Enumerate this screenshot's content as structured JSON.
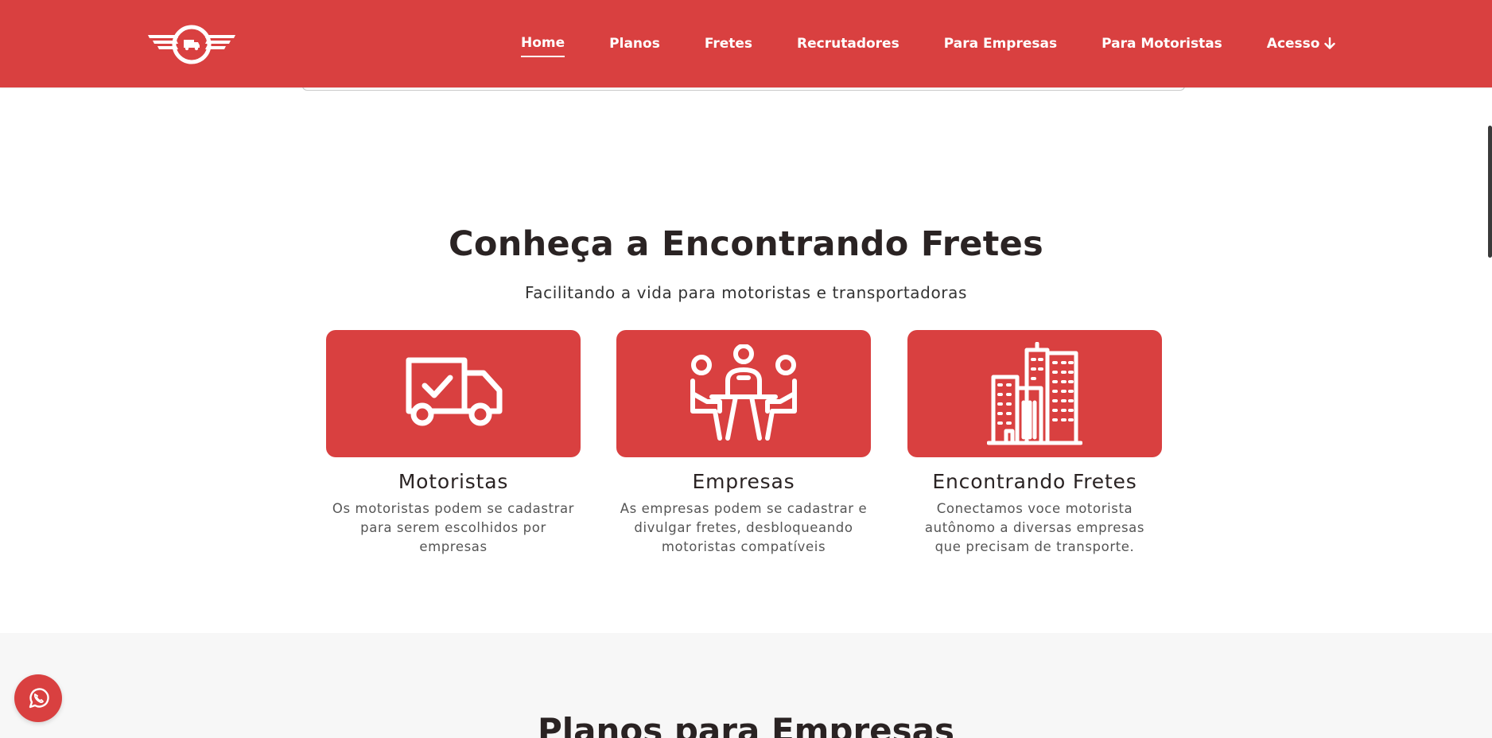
{
  "colors": {
    "brand_red": "#d94040",
    "text_dark": "#2a2323",
    "text_muted": "#555555",
    "section_grey": "#f7f7f7"
  },
  "nav": {
    "logo_icon": "truck-wings-logo",
    "links": [
      {
        "label": "Home",
        "active": true
      },
      {
        "label": "Planos"
      },
      {
        "label": "Fretes"
      },
      {
        "label": "Recrutadores"
      },
      {
        "label": "Para Empresas"
      },
      {
        "label": "Para Motoristas"
      },
      {
        "label": "Acesso",
        "icon": "arrow-down-icon"
      }
    ]
  },
  "about": {
    "title": "Conheça a Encontrando Fretes",
    "subtitle": "Facilitando a vida para motoristas e transportadoras",
    "cards": [
      {
        "icon": "truck-check-icon",
        "title": "Motoristas",
        "text": "Os motoristas podem se cadastrar para serem escolhidos por empresas"
      },
      {
        "icon": "meeting-people-icon",
        "title": "Empresas",
        "text": "As empresas podem se cadastrar e divulgar fretes, desbloqueando motoristas compatíveis"
      },
      {
        "icon": "buildings-icon",
        "title": "Encontrando Fretes",
        "text": "Conectamos voce motorista autônomo a diversas empresas que precisam de transporte."
      }
    ]
  },
  "plans": {
    "title": "Planos para Empresas"
  },
  "whatsapp": {
    "icon": "whatsapp-icon"
  }
}
